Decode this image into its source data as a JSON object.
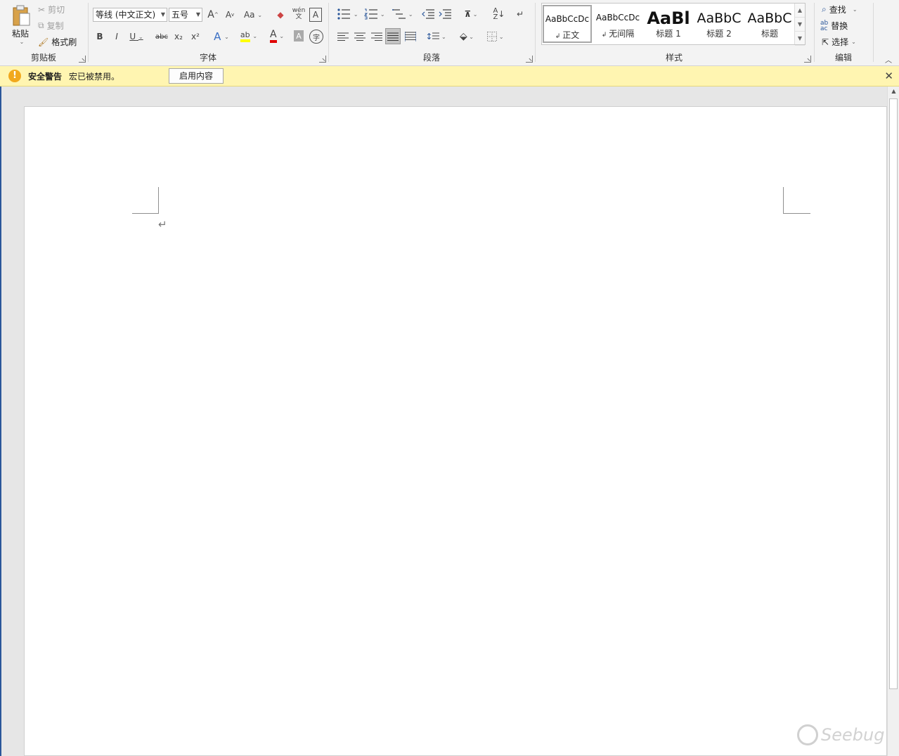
{
  "clipboard": {
    "paste_label": "粘贴",
    "cut_label": "剪切",
    "copy_label": "复制",
    "format_painter_label": "格式刷",
    "group_label": "剪贴板"
  },
  "font": {
    "font_name": "等线 (中文正文)",
    "font_size": "五号",
    "group_label": "字体",
    "grow_label": "A",
    "shrink_label": "A",
    "case_label": "Aa",
    "pinyin_label": "wén",
    "border_label": "A",
    "bold_label": "B",
    "italic_label": "I",
    "underline_label": "U",
    "strike_label": "abc",
    "sub_label": "x₂",
    "sup_label": "x²",
    "effects_label": "A",
    "color_label": "A",
    "shading_label": "A",
    "enclose_label": "字"
  },
  "paragraph": {
    "group_label": "段落"
  },
  "styles": {
    "group_label": "样式",
    "items": [
      {
        "preview": "AaBbCcDc",
        "name": "正文",
        "selected": true
      },
      {
        "preview": "AaBbCcDc",
        "name": "无间隔",
        "selected": false
      },
      {
        "preview": "AaBl",
        "name": "标题 1",
        "selected": false
      },
      {
        "preview": "AaBbC",
        "name": "标题 2",
        "selected": false
      },
      {
        "preview": "AaBbC",
        "name": "标题",
        "selected": false
      }
    ]
  },
  "editing": {
    "group_label": "编辑",
    "find_label": "查找",
    "replace_label": "替换",
    "select_label": "选择"
  },
  "security_bar": {
    "title": "安全警告",
    "message": "宏已被禁用。",
    "enable_button": "启用内容"
  },
  "watermark": {
    "text": "Seebug"
  }
}
